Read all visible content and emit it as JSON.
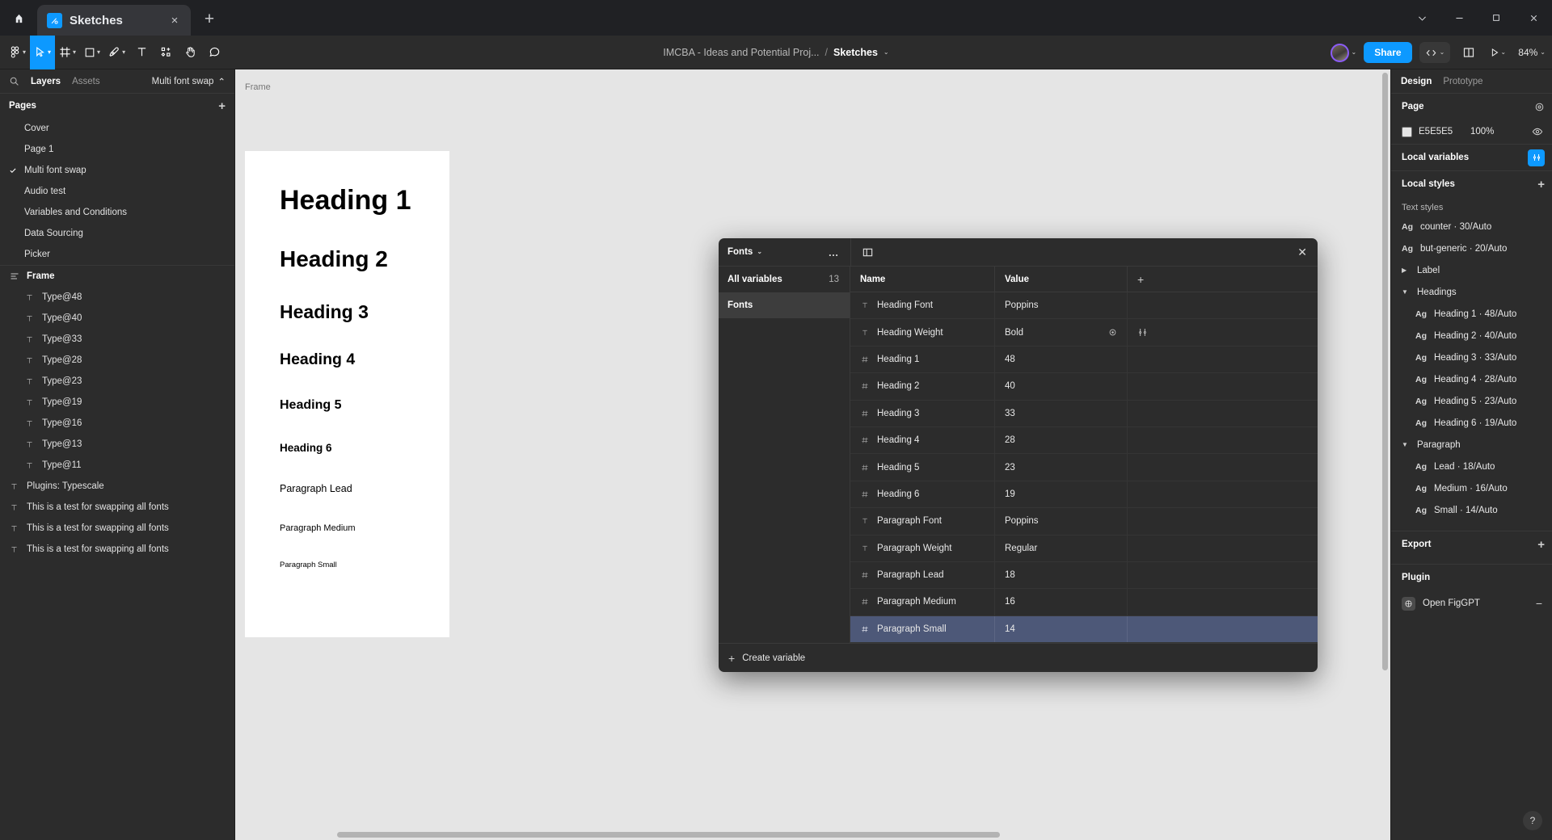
{
  "browser": {
    "home_icon": "home-icon",
    "tab": {
      "title": "Sketches",
      "favicon": "figma-icon",
      "close": "×"
    },
    "new_tab": "+",
    "window_controls": {
      "minimize_overflow": "⌄",
      "minimize": "─",
      "maximize": "□",
      "close": "✕"
    }
  },
  "toolbar": {
    "menu_icon": "figma-logo-icon",
    "tools": [
      {
        "name": "move-tool",
        "icon": "cursor-icon",
        "caret": "⌄",
        "active": true
      },
      {
        "name": "frame-tool",
        "icon": "frame-icon",
        "caret": "⌄",
        "active": false
      },
      {
        "name": "shape-tool",
        "icon": "square-icon",
        "caret": "⌄",
        "active": false
      },
      {
        "name": "pen-tool",
        "icon": "pen-icon",
        "caret": "⌄",
        "active": false
      },
      {
        "name": "text-tool",
        "icon": "text-icon",
        "caret": "",
        "active": false
      },
      {
        "name": "actions-tool",
        "icon": "actions-icon",
        "caret": "",
        "active": false
      },
      {
        "name": "hand-tool",
        "icon": "hand-icon",
        "caret": "",
        "active": false
      },
      {
        "name": "comment-tool",
        "icon": "comment-icon",
        "caret": "",
        "active": false
      }
    ],
    "breadcrumb": {
      "project": "IMCBA - Ideas and Potential Proj...",
      "separator": "/",
      "file": "Sketches",
      "file_caret": "⌄"
    },
    "share_label": "Share",
    "dev_mode_icon": "code-icon",
    "dev_mode_caret": "⌄",
    "present_icon": "play-icon",
    "present_caret": "⌄",
    "library_icon": "book-icon",
    "avatar_caret": "⌄",
    "zoom_level": "84%",
    "zoom_caret": "⌄"
  },
  "left_panel": {
    "search_icon": "search-icon",
    "tabs": [
      {
        "label": "Layers",
        "active": true
      },
      {
        "label": "Assets",
        "active": false
      }
    ],
    "page_selector": {
      "label": "Multi font swap",
      "caret": "⌃"
    },
    "pages_header": "Pages",
    "pages_add": "+",
    "pages": [
      {
        "label": "Cover",
        "selected": false
      },
      {
        "label": "Page 1",
        "selected": false
      },
      {
        "label": "Multi font swap",
        "selected": true
      },
      {
        "label": "Audio test",
        "selected": false
      },
      {
        "label": "Variables and Conditions",
        "selected": false
      },
      {
        "label": "Data Sourcing",
        "selected": false
      },
      {
        "label": "Picker",
        "selected": false
      }
    ],
    "layers": [
      {
        "label": "Frame",
        "icon": "frame-layer-icon",
        "depth": 0,
        "bold": true
      },
      {
        "label": "Type@48",
        "icon": "text-layer-icon",
        "depth": 1,
        "bold": false
      },
      {
        "label": "Type@40",
        "icon": "text-layer-icon",
        "depth": 1,
        "bold": false
      },
      {
        "label": "Type@33",
        "icon": "text-layer-icon",
        "depth": 1,
        "bold": false
      },
      {
        "label": "Type@28",
        "icon": "text-layer-icon",
        "depth": 1,
        "bold": false
      },
      {
        "label": "Type@23",
        "icon": "text-layer-icon",
        "depth": 1,
        "bold": false
      },
      {
        "label": "Type@19",
        "icon": "text-layer-icon",
        "depth": 1,
        "bold": false
      },
      {
        "label": "Type@16",
        "icon": "text-layer-icon",
        "depth": 1,
        "bold": false
      },
      {
        "label": "Type@13",
        "icon": "text-layer-icon",
        "depth": 1,
        "bold": false
      },
      {
        "label": "Type@11",
        "icon": "text-layer-icon",
        "depth": 1,
        "bold": false
      },
      {
        "label": "Plugins: Typescale",
        "icon": "text-layer-icon",
        "depth": 0,
        "bold": false
      },
      {
        "label": "This is a test for swapping all fonts",
        "icon": "text-layer-icon",
        "depth": 0,
        "bold": false
      },
      {
        "label": "This is a test for swapping all fonts",
        "icon": "text-layer-icon",
        "depth": 0,
        "bold": false
      },
      {
        "label": "This is a test for swapping all fonts",
        "icon": "text-layer-icon",
        "depth": 0,
        "bold": false
      }
    ]
  },
  "canvas": {
    "frame_label": "Frame",
    "background": "#E5E5E5",
    "specimens": [
      {
        "text": "Heading 1",
        "class": "h1"
      },
      {
        "text": "Heading 2",
        "class": "h2"
      },
      {
        "text": "Heading 3",
        "class": "h3"
      },
      {
        "text": "Heading 4",
        "class": "h4"
      },
      {
        "text": "Heading 5",
        "class": "h5"
      },
      {
        "text": "Heading 6",
        "class": "h6"
      },
      {
        "text": "Paragraph Lead",
        "class": "pl"
      },
      {
        "text": "Paragraph Medium",
        "class": "pm"
      },
      {
        "text": "Paragraph Small",
        "class": "ps"
      }
    ]
  },
  "variables_modal": {
    "collection_name": "Fonts",
    "collection_caret": "⌄",
    "more_icon": "more-horizontal-icon",
    "panel_toggle_icon": "sidebar-toggle-icon",
    "close_icon": "✕",
    "sidebar": [
      {
        "label": "All variables",
        "count": "13",
        "selected": false
      },
      {
        "label": "Fonts",
        "count": "",
        "selected": true
      }
    ],
    "columns": {
      "name": "Name",
      "value": "Value",
      "add": "+"
    },
    "rows": [
      {
        "type": "string",
        "name": "Heading Font",
        "value": "Poppins",
        "selected": false,
        "scope_icon": false,
        "tweak_icon": false
      },
      {
        "type": "string",
        "name": "Heading Weight",
        "value": "Bold",
        "selected": false,
        "scope_icon": true,
        "tweak_icon": true
      },
      {
        "type": "number",
        "name": "Heading 1",
        "value": "48",
        "selected": false,
        "scope_icon": false,
        "tweak_icon": false
      },
      {
        "type": "number",
        "name": "Heading 2",
        "value": "40",
        "selected": false,
        "scope_icon": false,
        "tweak_icon": false
      },
      {
        "type": "number",
        "name": "Heading 3",
        "value": "33",
        "selected": false,
        "scope_icon": false,
        "tweak_icon": false
      },
      {
        "type": "number",
        "name": "Heading 4",
        "value": "28",
        "selected": false,
        "scope_icon": false,
        "tweak_icon": false
      },
      {
        "type": "number",
        "name": "Heading 5",
        "value": "23",
        "selected": false,
        "scope_icon": false,
        "tweak_icon": false
      },
      {
        "type": "number",
        "name": "Heading 6",
        "value": "19",
        "selected": false,
        "scope_icon": false,
        "tweak_icon": false
      },
      {
        "type": "string",
        "name": "Paragraph Font",
        "value": "Poppins",
        "selected": false,
        "scope_icon": false,
        "tweak_icon": false
      },
      {
        "type": "string",
        "name": "Paragraph Weight",
        "value": "Regular",
        "selected": false,
        "scope_icon": false,
        "tweak_icon": false
      },
      {
        "type": "number",
        "name": "Paragraph Lead",
        "value": "18",
        "selected": false,
        "scope_icon": false,
        "tweak_icon": false
      },
      {
        "type": "number",
        "name": "Paragraph Medium",
        "value": "16",
        "selected": false,
        "scope_icon": false,
        "tweak_icon": false
      },
      {
        "type": "number",
        "name": "Paragraph Small",
        "value": "14",
        "selected": true,
        "scope_icon": false,
        "tweak_icon": false
      }
    ],
    "create_variable": "Create variable",
    "create_plus": "+"
  },
  "right_panel": {
    "tabs": [
      {
        "label": "Design",
        "active": true
      },
      {
        "label": "Prototype",
        "active": false
      }
    ],
    "page_section": {
      "title": "Page",
      "settings_icon": "page-settings-icon"
    },
    "page_color": {
      "hex": "E5E5E5",
      "opacity": "100%",
      "eye_icon": "eye-icon",
      "swatch": "#E5E5E5"
    },
    "local_variables": {
      "title": "Local variables",
      "button_icon": "variables-icon"
    },
    "local_styles": {
      "title": "Local styles",
      "plus": "+"
    },
    "text_styles_label": "Text styles",
    "text_styles": [
      {
        "kind": "style",
        "ag": "Ag",
        "label": "counter · 30/Auto",
        "indent": false
      },
      {
        "kind": "style",
        "ag": "Ag",
        "label": "but-generic · 20/Auto",
        "indent": false
      },
      {
        "kind": "group",
        "caret": "▶",
        "label": "Label",
        "indent": false
      },
      {
        "kind": "group",
        "caret": "▼",
        "label": "Headings",
        "indent": false
      },
      {
        "kind": "style",
        "ag": "Ag",
        "label": "Heading 1 · 48/Auto",
        "indent": true
      },
      {
        "kind": "style",
        "ag": "Ag",
        "label": "Heading 2 · 40/Auto",
        "indent": true
      },
      {
        "kind": "style",
        "ag": "Ag",
        "label": "Heading 3 · 33/Auto",
        "indent": true
      },
      {
        "kind": "style",
        "ag": "Ag",
        "label": "Heading 4 · 28/Auto",
        "indent": true
      },
      {
        "kind": "style",
        "ag": "Ag",
        "label": "Heading 5 · 23/Auto",
        "indent": true
      },
      {
        "kind": "style",
        "ag": "Ag",
        "label": "Heading 6 · 19/Auto",
        "indent": true
      },
      {
        "kind": "group",
        "caret": "▼",
        "label": "Paragraph",
        "indent": false
      },
      {
        "kind": "style",
        "ag": "Ag",
        "label": "Lead · 18/Auto",
        "indent": true
      },
      {
        "kind": "style",
        "ag": "Ag",
        "label": "Medium · 16/Auto",
        "indent": true
      },
      {
        "kind": "style",
        "ag": "Ag",
        "label": "Small · 14/Auto",
        "indent": true
      }
    ],
    "export": {
      "title": "Export",
      "plus": "+"
    },
    "plugin_section": {
      "title": "Plugin"
    },
    "plugin": {
      "name": "Open FigGPT",
      "icon": "plugin-icon",
      "minus": "−"
    },
    "help": "?"
  }
}
